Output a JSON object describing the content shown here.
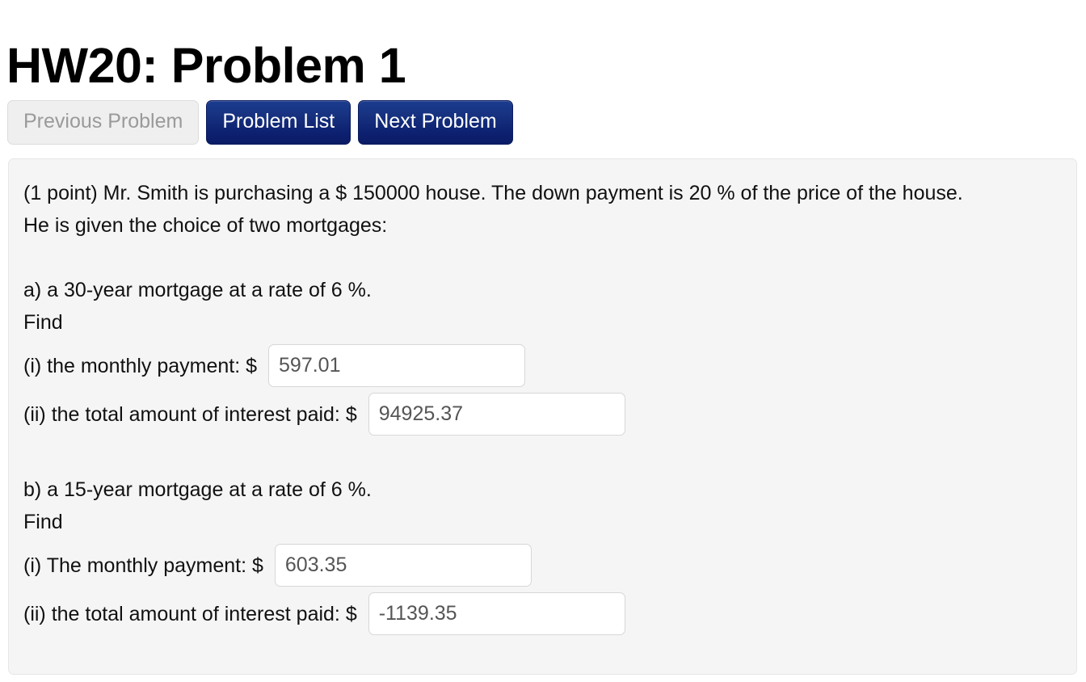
{
  "header": {
    "title": "HW20: Problem 1"
  },
  "nav": {
    "buttons": [
      {
        "label": "Previous Problem",
        "state": "disabled"
      },
      {
        "label": "Problem List",
        "state": "primary"
      },
      {
        "label": "Next Problem",
        "state": "primary"
      }
    ]
  },
  "problem": {
    "statement_line1": "(1 point) Mr. Smith is purchasing a $ 150000 house. The down payment is 20 % of the price of the house.",
    "statement_line2": "He is given the choice of two mortgages:",
    "parts": [
      {
        "heading": "a) a 30-year mortgage at a rate of 6 %.",
        "find_label": "Find",
        "answers": [
          {
            "label": "(i) the monthly payment: $",
            "value": "597.01",
            "placeholder": ""
          },
          {
            "label": "(ii) the total amount of interest paid: $",
            "value": "94925.37",
            "placeholder": ""
          }
        ]
      },
      {
        "heading": "b) a 15-year mortgage at a rate of 6 %.",
        "find_label": "Find",
        "answers": [
          {
            "label": "(i) The monthly payment: $",
            "value": "603.35",
            "placeholder": ""
          },
          {
            "label": "(ii) the total amount of interest paid: $",
            "value": "-1139.35",
            "placeholder": ""
          }
        ]
      }
    ]
  },
  "colors": {
    "primary_button_top": "#1b3c8e",
    "primary_button_bottom": "#0b1c66",
    "panel_background": "#f5f5f5",
    "panel_border": "#e6e6e6",
    "disabled_button_background": "#efefef",
    "disabled_button_text": "#9a9a9a",
    "input_text": "#555555",
    "body_text": "#111111"
  }
}
